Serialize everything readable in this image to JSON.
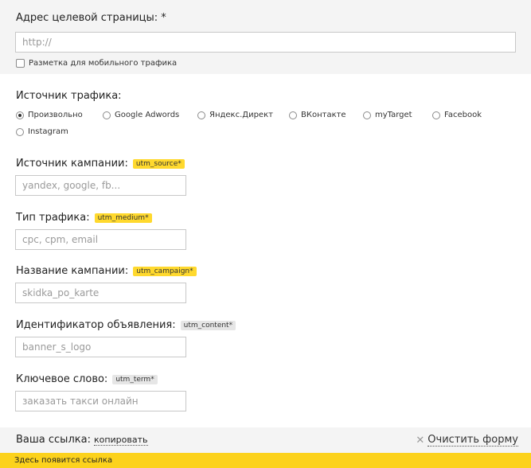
{
  "target_url": {
    "label": "Адрес целевой страницы: *",
    "placeholder": "http://",
    "mobile_checkbox_label": "Разметка для мобильного трафика"
  },
  "traffic_source": {
    "label": "Источник трафика:",
    "options": [
      "Произвольно",
      "Google Adwords",
      "Яндекс.Директ",
      "ВКонтакте",
      "myTarget",
      "Facebook",
      "Instagram"
    ],
    "selected": "Произвольно"
  },
  "fields": {
    "source": {
      "label": "Источник кампании:",
      "tag": "utm_source*",
      "placeholder": "yandex, google, fb..."
    },
    "medium": {
      "label": "Тип трафика:",
      "tag": "utm_medium*",
      "placeholder": "cpc, cpm, email"
    },
    "campaign": {
      "label": "Название кампании:",
      "tag": "utm_campaign*",
      "placeholder": "skidka_po_karte"
    },
    "content": {
      "label": "Идентификатор объявления:",
      "tag": "utm_content*",
      "placeholder": "banner_s_logo"
    },
    "term": {
      "label": "Ключевое слово:",
      "tag": "utm_term*",
      "placeholder": "заказать такси онлайн"
    }
  },
  "footer": {
    "link_label": "Ваша ссылка:",
    "copy_label": "копировать",
    "clear_label": "Очистить форму",
    "result_placeholder": "Здесь появится ссылка"
  },
  "colors": {
    "required_tag": "#ffd92e",
    "optional_tag": "#e6e6e6",
    "result_bar": "#fcd21c",
    "panel_bg": "#f4f4f4"
  }
}
